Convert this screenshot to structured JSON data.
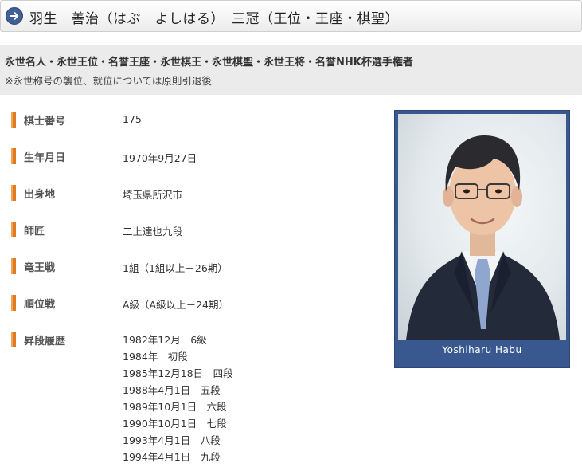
{
  "header": {
    "icon": "arrow-right-circle-icon",
    "title": "羽生　善治（はぶ　よしはる）　三冠（王位・王座・棋聖）"
  },
  "titles": {
    "main": "永世名人・永世王位・名誉王座・永世棋王・永世棋聖・永世王将・名誉NHK杯選手権者",
    "note": "※永世称号の襲位、就位については原則引退後"
  },
  "profile": {
    "rows": [
      {
        "label": "棋士番号",
        "value": "175"
      },
      {
        "label": "生年月日",
        "value": "1970年9月27日"
      },
      {
        "label": "出身地",
        "value": "埼玉県所沢市"
      },
      {
        "label": "師匠",
        "value": "二上達也九段"
      },
      {
        "label": "竜王戦",
        "value": "1組（1組以上－26期）"
      },
      {
        "label": "順位戦",
        "value": "A級（A級以上－24期）"
      }
    ],
    "history_label": "昇段履歴",
    "history": [
      "1982年12月　6級",
      "1984年　初段",
      "1985年12月18日　四段",
      "1988年4月1日　五段",
      "1989年10月1日　六段",
      "1990年10月1日　七段",
      "1993年4月1日　八段",
      "1994年4月1日　九段"
    ]
  },
  "photo": {
    "caption": "Yoshiharu Habu",
    "accent": "#38588f",
    "marker_color": "#e07b1f"
  }
}
